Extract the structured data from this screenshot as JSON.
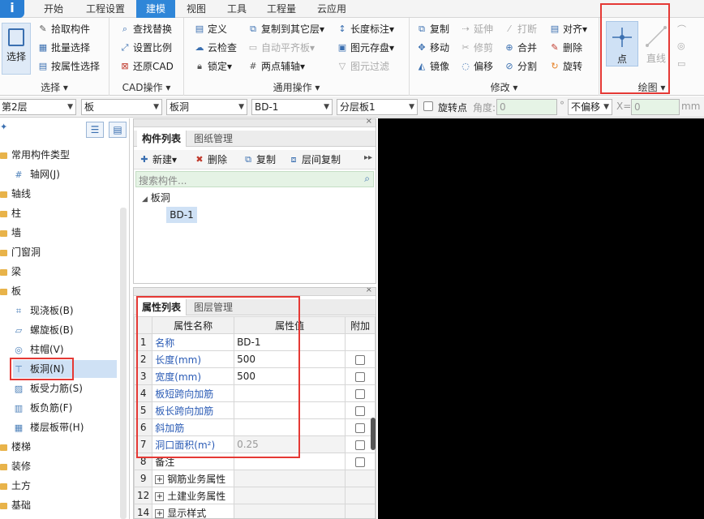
{
  "app": {
    "logo": "i"
  },
  "menu": {
    "tabs": [
      {
        "label": "开始"
      },
      {
        "label": "工程设置"
      },
      {
        "label": "建模"
      },
      {
        "label": "视图"
      },
      {
        "label": "工具"
      },
      {
        "label": "工程量"
      },
      {
        "label": "云应用"
      }
    ],
    "active": "建模"
  },
  "ribbon": {
    "select": {
      "big": "选择",
      "pick": "拾取构件",
      "batch": "批量选择",
      "by_attr": "按属性选择",
      "title": "选择"
    },
    "cad": {
      "find": "查找替换",
      "scale": "设置比例",
      "restore": "还原CAD",
      "title": "CAD操作"
    },
    "general": {
      "define": "定义",
      "copy_to": "复制到其它层",
      "length_mark": "长度标注",
      "cloud_check": "云检查",
      "auto_flat": "自动平齐板",
      "save_pic": "图元存盘",
      "lock": "锁定",
      "two_axis": "两点辅轴",
      "filter": "图元过滤",
      "title": "通用操作"
    },
    "modify": {
      "copy": "复制",
      "extend": "延伸",
      "break": "打断",
      "align": "对齐",
      "move": "移动",
      "trim": "修剪",
      "merge": "合并",
      "delete": "删除",
      "mirror": "镜像",
      "offset": "偏移",
      "split": "分割",
      "rotate": "旋转",
      "title": "修改"
    },
    "draw": {
      "point": "点",
      "line": "直线",
      "title": "绘图"
    }
  },
  "toolbar": {
    "floor": "第2层",
    "type": "板",
    "subtype": "板洞",
    "element": "BD-1",
    "layer": "分层板1",
    "rotate_point": "旋转点",
    "angle_label": "角度:",
    "angle_value": "0",
    "degree": "°",
    "offset": "不偏移",
    "x_label": "X=",
    "x_value": "0",
    "unit": "mm"
  },
  "tree": {
    "items": [
      {
        "label": "常用构件类型",
        "kind": "folder"
      },
      {
        "label": "轴网(J)",
        "kind": "child"
      },
      {
        "label": "轴线",
        "kind": "folder"
      },
      {
        "label": "柱",
        "kind": "folder"
      },
      {
        "label": "墙",
        "kind": "folder"
      },
      {
        "label": "门窗洞",
        "kind": "folder"
      },
      {
        "label": "梁",
        "kind": "folder"
      },
      {
        "label": "板",
        "kind": "folder"
      },
      {
        "label": "现浇板(B)",
        "kind": "child"
      },
      {
        "label": "螺旋板(B)",
        "kind": "child"
      },
      {
        "label": "柱帽(V)",
        "kind": "child"
      },
      {
        "label": "板洞(N)",
        "kind": "child",
        "selected": true
      },
      {
        "label": "板受力筋(S)",
        "kind": "child"
      },
      {
        "label": "板负筋(F)",
        "kind": "child"
      },
      {
        "label": "楼层板带(H)",
        "kind": "child"
      },
      {
        "label": "楼梯",
        "kind": "folder"
      },
      {
        "label": "装修",
        "kind": "folder"
      },
      {
        "label": "土方",
        "kind": "folder"
      },
      {
        "label": "基础",
        "kind": "folder"
      }
    ]
  },
  "component_panel": {
    "tabs": [
      "构件列表",
      "图纸管理"
    ],
    "new": "新建",
    "delete": "删除",
    "copy": "复制",
    "floor_copy": "层间复制",
    "search_placeholder": "搜索构件...",
    "group": "板洞",
    "item": "BD-1"
  },
  "property_panel": {
    "tabs": [
      "属性列表",
      "图层管理"
    ],
    "headers": [
      "属性名称",
      "属性值",
      "附加"
    ],
    "rows": [
      {
        "n": "1",
        "name": "名称",
        "value": "BD-1",
        "check": false
      },
      {
        "n": "2",
        "name": "长度(mm)",
        "value": "500",
        "check": true
      },
      {
        "n": "3",
        "name": "宽度(mm)",
        "value": "500",
        "check": true
      },
      {
        "n": "4",
        "name": "板短跨向加筋",
        "value": "",
        "check": true
      },
      {
        "n": "5",
        "name": "板长跨向加筋",
        "value": "",
        "check": true
      },
      {
        "n": "6",
        "name": "斜加筋",
        "value": "",
        "check": true
      },
      {
        "n": "7",
        "name": "洞口面积(m²)",
        "value": "0.25",
        "check": true
      },
      {
        "n": "8",
        "name": "备注",
        "value": "",
        "check": true
      },
      {
        "n": "9",
        "name": "钢筋业务属性",
        "value": "",
        "check": false,
        "expand": true
      },
      {
        "n": "12",
        "name": "土建业务属性",
        "value": "",
        "check": false,
        "expand": true
      },
      {
        "n": "14",
        "name": "显示样式",
        "value": "",
        "check": false,
        "expand": true
      }
    ]
  },
  "colors": {
    "accent": "#2f86d8",
    "highlight": "#e53935",
    "link": "#2a5bb5"
  }
}
